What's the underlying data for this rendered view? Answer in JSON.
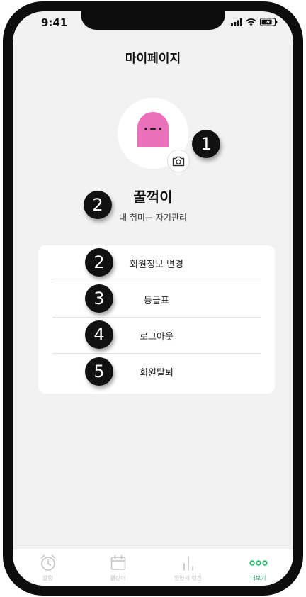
{
  "status_bar": {
    "time": "9:41"
  },
  "header": {
    "title": "마이페이지"
  },
  "profile": {
    "nickname": "꿀꺽이",
    "bio": "내 취미는 자기관리",
    "avatar_color": "#ec6fbc"
  },
  "annotations": [
    "1",
    "2",
    "2",
    "3",
    "4",
    "5"
  ],
  "menu": {
    "items": [
      {
        "label": "회원정보 변경"
      },
      {
        "label": "등급표"
      },
      {
        "label": "로그아웃"
      },
      {
        "label": "회원탈퇴"
      }
    ]
  },
  "tabbar": {
    "tabs": [
      {
        "label": "알람",
        "icon": "alarm-clock-icon"
      },
      {
        "label": "캘린더",
        "icon": "calendar-icon"
      },
      {
        "label": "영양제 랭킹",
        "icon": "ranking-bars-icon"
      },
      {
        "label": "더보기",
        "icon": "more-dots-icon"
      }
    ],
    "active_color": "#2bb673",
    "inactive_color": "#c4c4c4"
  }
}
